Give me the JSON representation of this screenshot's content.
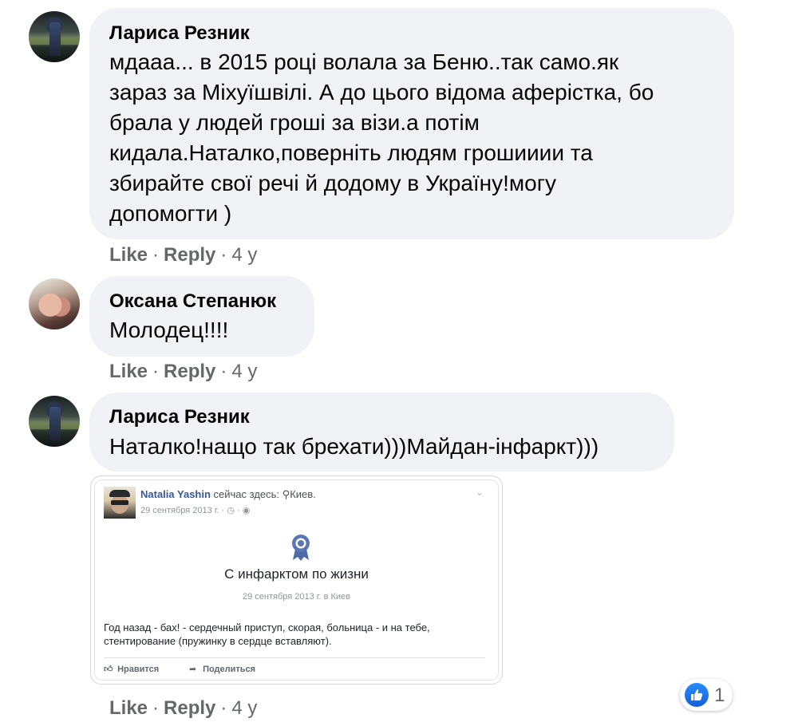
{
  "comments": [
    {
      "author": "Лариса Резник",
      "text": "мдааа... в 2015 році волала за Беню..так само.як\nзараз за Міхуїшвілі. А до цього відома аферістка, бо\nбрала у людей гроші за візи.а потім\nкидала.Наталко,поверніть людям грошииии та\nзбирайте свої речі й додому в Україну!могу\nдопомогти )",
      "like": "Like",
      "reply": "Reply",
      "sep": "·",
      "time": "4 y"
    },
    {
      "author": "Оксана Степанюк",
      "text": "Молодец!!!!",
      "like": "Like",
      "reply": "Reply",
      "sep": "·",
      "time": "4 y"
    },
    {
      "author": "Лариса Резник",
      "text": "Наталко!нащо так брехати)))Майдан-інфаркт)))",
      "like": "Like",
      "reply": "Reply",
      "sep": "·",
      "time": "4 y",
      "reaction_count": "1"
    }
  ],
  "attachment": {
    "poster_name": "Natalia Yashin",
    "location_prefix": "сейчас здесь:",
    "location": "Киев.",
    "date": "29 сентября 2013 г. ·",
    "event_title": "С инфарктом по жизни",
    "event_subtitle": "29 сентября 2013 г. в Киев",
    "body": "Год назад - бах! - сердечный приступ, скорая, больница - и на тебе, стентирование (пружинку в сердце вставляют).",
    "like_action": "Нравится",
    "share_action": "Поделиться"
  },
  "icons": {
    "location": "map-pin-icon",
    "privacy": "globe-icon",
    "event": "award-badge-icon",
    "reaction": "thumbs-up-icon"
  },
  "colors": {
    "bubble": "#f0f2f5",
    "link": "#365899",
    "like_blue": "#1877f2",
    "meta": "#65676b"
  }
}
